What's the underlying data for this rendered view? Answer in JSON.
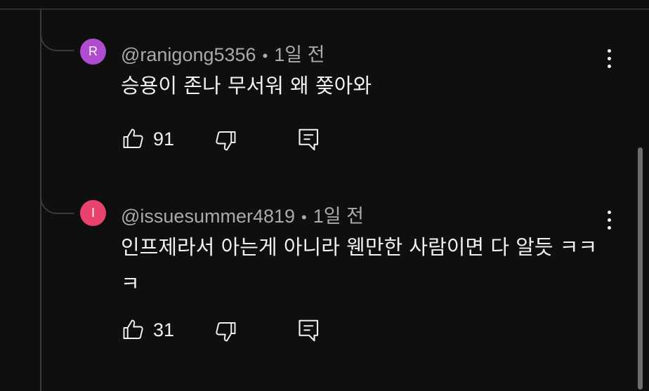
{
  "comments": [
    {
      "avatar_letter": "R",
      "avatar_color": "#b04ccf",
      "handle": "@ranigong5356",
      "separator": "•",
      "time": "1일 전",
      "text": "승용이 존나 무서워 왜 쫒아와",
      "likes": "91"
    },
    {
      "avatar_letter": "I",
      "avatar_color": "#e8426f",
      "handle": "@issuesummer4819",
      "separator": "•",
      "time": "1일 전",
      "text": "인프제라서 아는게 아니라 웬만한 사람이면 다 알듯 ㅋㅋㅋ",
      "likes": "31"
    }
  ],
  "icons": {
    "like": "thumbs-up-icon",
    "dislike": "thumbs-down-icon",
    "reply": "reply-icon",
    "more": "more-vertical-icon"
  }
}
